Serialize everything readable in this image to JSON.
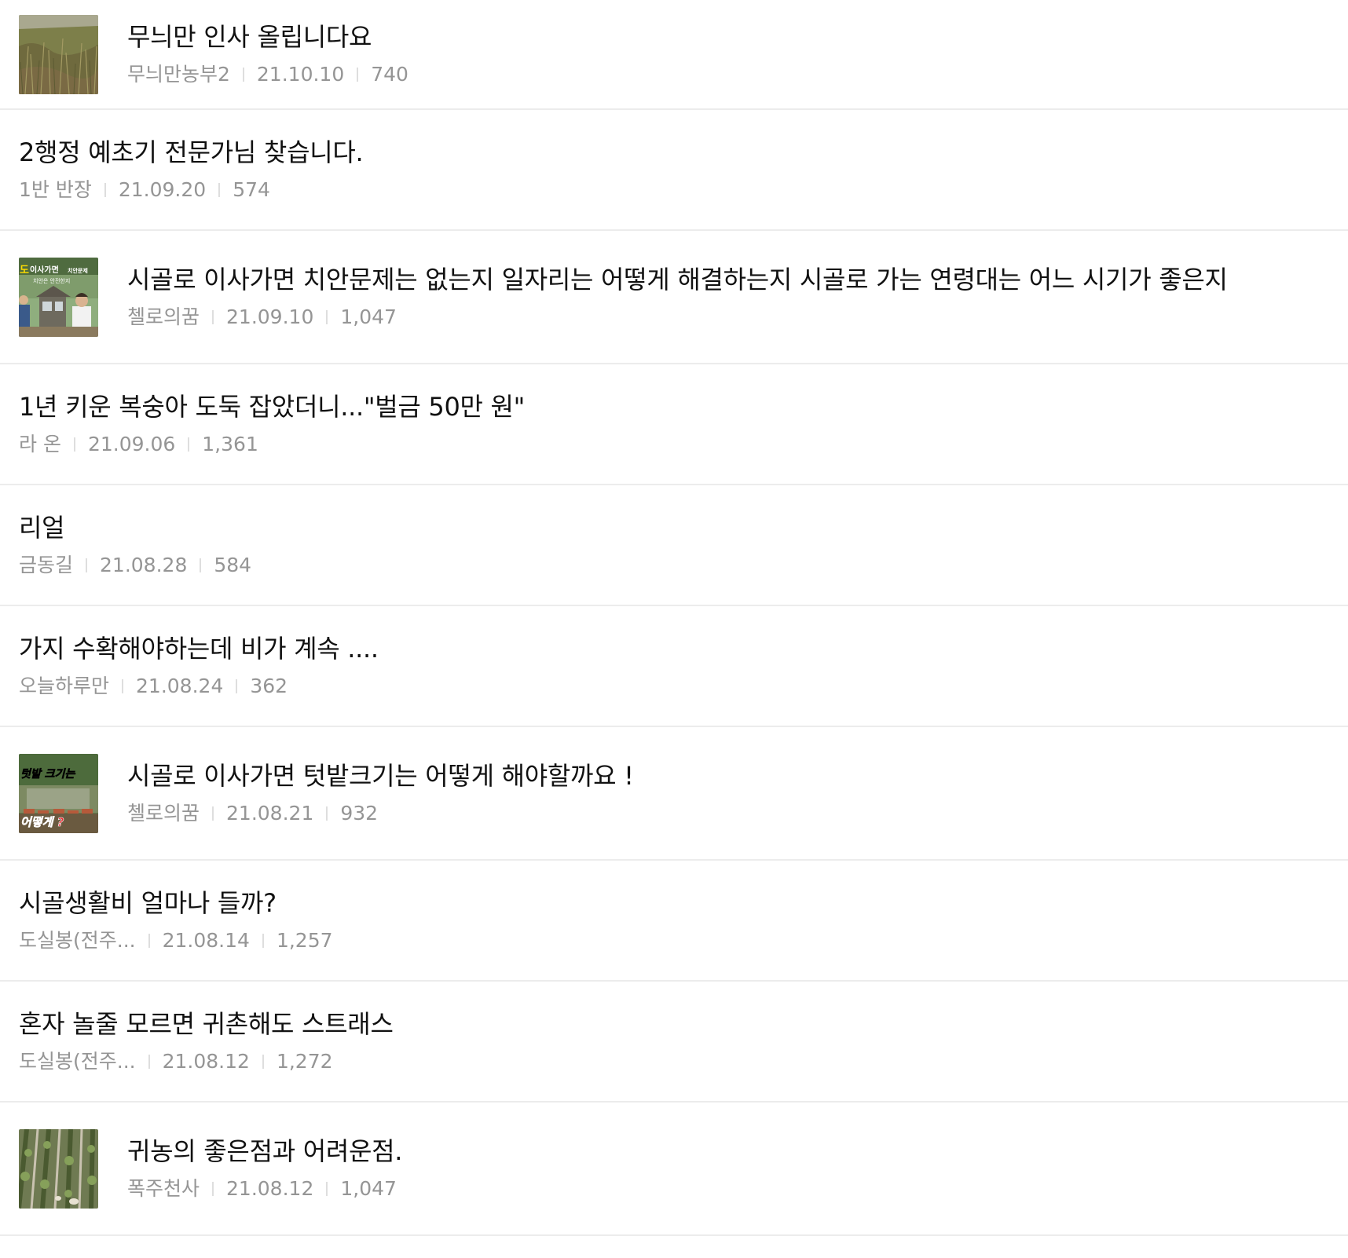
{
  "posts": [
    {
      "title": "무늬만 인사 올립니다요",
      "author": "무늬만농부2",
      "date": "21.10.10",
      "views": "740",
      "thumbnail": "grass-field"
    },
    {
      "title": "2행정 예초기 전문가님 찾습니다.",
      "author": "1반 반장",
      "date": "21.09.20",
      "views": "574"
    },
    {
      "title": "시골로 이사가면 치안문제는 없는지 일자리는 어떻게 해결하는지 시골로 가는 연령대는 어느 시기가 좋은지",
      "author": "첼로의꿈",
      "date": "21.09.10",
      "views": "1,047",
      "thumbnail": "video-house"
    },
    {
      "title": "1년 키운 복숭아 도둑 잡았더니...\"벌금 50만 원\"",
      "author": "라 온",
      "date": "21.09.06",
      "views": "1,361"
    },
    {
      "title": "리얼",
      "author": "금동길",
      "date": "21.08.28",
      "views": "584"
    },
    {
      "title": "가지 수확해야하는데 비가 계속 ....",
      "author": "오늘하루만",
      "date": "21.08.24",
      "views": "362"
    },
    {
      "title": "시골로 이사가면 텃밭크기는 어떻게 해야할까요 !",
      "author": "첼로의꿈",
      "date": "21.08.21",
      "views": "932",
      "thumbnail": "video-garden"
    },
    {
      "title": "시골생활비 얼마나 들까?",
      "author": "도실봉(전주...",
      "date": "21.08.14",
      "views": "1,257"
    },
    {
      "title": "혼자 놀줄 모르면 귀촌해도 스트래스",
      "author": "도실봉(전주...",
      "date": "21.08.12",
      "views": "1,272"
    },
    {
      "title": "귀농의 좋은점과 어려운점.",
      "author": "폭주천사",
      "date": "21.08.12",
      "views": "1,047",
      "thumbnail": "crop-rows"
    }
  ],
  "thumb_text": {
    "video_house_top": "이사가면",
    "video_house_top2": "치안문제",
    "video_house_sub": "치안은 안전한지",
    "video_house_corner": "도",
    "video_garden_top": "텃밭 크기는",
    "video_garden_bottom": "어떻게 ?"
  }
}
